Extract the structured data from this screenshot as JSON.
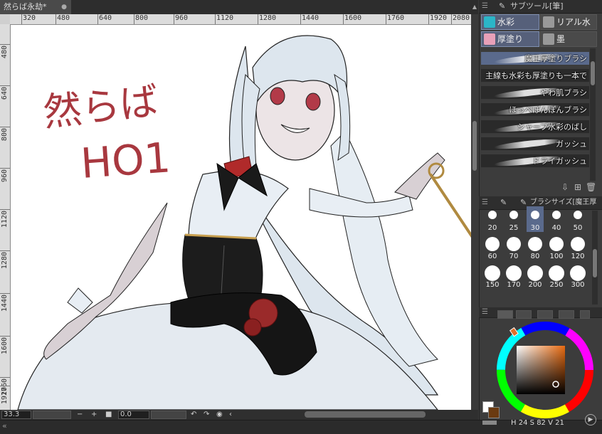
{
  "document": {
    "tab_title": "然らば永劫*",
    "close_glyph": "●"
  },
  "ruler_top": {
    "labels": [
      "320",
      "480",
      "640",
      "800",
      "960",
      "1120",
      "1280",
      "1440",
      "1600",
      "1760",
      "1920",
      "2080"
    ]
  },
  "ruler_left": {
    "labels": [
      "480",
      "640",
      "800",
      "960",
      "1120",
      "1280",
      "1440",
      "1600",
      "1760",
      "1920"
    ]
  },
  "canvas_text": {
    "line1": "然らば",
    "line2": "HO1",
    "ink_color": "#a8383f"
  },
  "statusbar": {
    "zoom": "33.3",
    "minus": "−",
    "plus": "+",
    "angle": "0.0"
  },
  "subtool_panel": {
    "title": "サブツール[筆]",
    "groups": [
      {
        "label": "水彩",
        "icon": "watercolor-icon",
        "color": "#2bb5c8",
        "selected": true
      },
      {
        "label": "リアル水彩",
        "icon": "real-watercolor-icon",
        "color": "#999999",
        "selected": false
      },
      {
        "label": "厚塗り",
        "icon": "thick-paint-icon",
        "color": "#e8a0b8",
        "selected": true
      },
      {
        "label": "墨",
        "icon": "ink-icon",
        "color": "#999999",
        "selected": false
      }
    ],
    "brushes": [
      {
        "label": "魔王厚塗りブラシ",
        "selected": true
      },
      {
        "label": "主線も水彩も厚塗りも一本で",
        "selected": false
      },
      {
        "label": "やわ肌ブラシ",
        "selected": false
      },
      {
        "label": "ほっぺぽんぽんブラシ",
        "selected": false
      },
      {
        "label": "シャープ水彩のばし",
        "selected": false
      },
      {
        "label": "ガッシュ",
        "selected": false
      },
      {
        "label": "ドライガッシュ",
        "selected": false
      }
    ]
  },
  "brush_size_panel": {
    "title": "ブラシサイズ[魔王厚塗",
    "sizes": [
      "20",
      "25",
      "30",
      "40",
      "50",
      "60",
      "70",
      "80",
      "100",
      "120",
      "150",
      "170",
      "200",
      "250",
      "300"
    ],
    "selected": "30"
  },
  "color_panel": {
    "current_color": "#6a3a10",
    "hue_marker_color": "#e07028",
    "readout_h": "24",
    "readout_s": "82",
    "readout_v": "21"
  }
}
